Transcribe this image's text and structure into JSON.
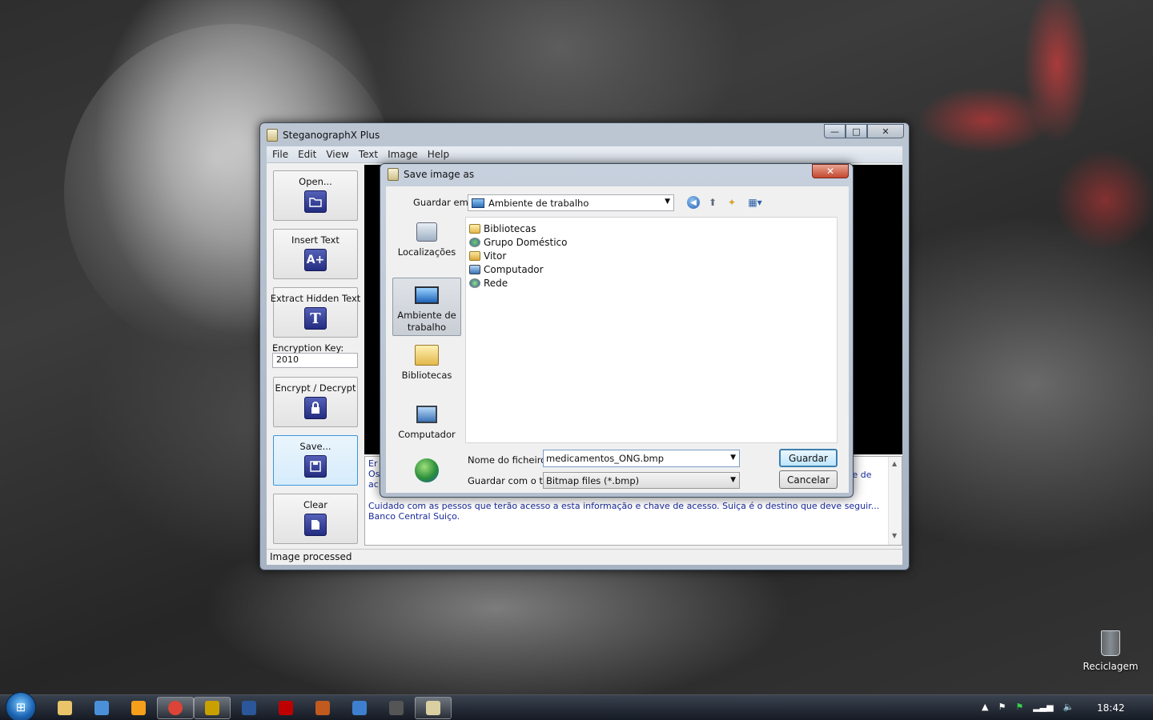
{
  "main_window": {
    "title": "SteganographX Plus",
    "menu": [
      "File",
      "Edit",
      "View",
      "Text",
      "Image",
      "Help"
    ],
    "buttons": {
      "open": "Open...",
      "insert_text": "Insert Text",
      "extract_hidden_text": "Extract Hidden Text",
      "encrypt_decrypt": "Encrypt / Decrypt",
      "save": "Save...",
      "clear": "Clear"
    },
    "icon_glyphs": {
      "insert": "A+",
      "extract": "T"
    },
    "encryption_key_label": "Encryption Key:",
    "encryption_key_value": "2010",
    "text_content": {
      "left_fragment_1": "Er",
      "left_fragment_2": "Os",
      "left_fragment_3": "ac",
      "right_fragment": "ve de",
      "line": "Cuidado com as pessos que terão acesso a esta informação e chave de acesso. Suiça é o destino que deve seguir... Banco Central Suiço."
    },
    "status": "Image processed",
    "caption_buttons": {
      "minimize": "—",
      "maximize": "□",
      "close": "✕"
    }
  },
  "save_dialog": {
    "title": "Save image as",
    "close_glyph": "✕",
    "look_in_label": "Guardar em:",
    "look_in_value": "Ambiente de trabalho",
    "places": [
      {
        "label": "Localizações",
        "icon": "recent-places-icon"
      },
      {
        "label": "Ambiente de trabalho",
        "icon": "desktop-icon"
      },
      {
        "label": "Bibliotecas",
        "icon": "libraries-icon"
      },
      {
        "label": "Computador",
        "icon": "computer-icon"
      },
      {
        "label": "",
        "icon": "network-icon"
      }
    ],
    "files": [
      {
        "name": "Bibliotecas",
        "icon": "libraries-icon"
      },
      {
        "name": "Grupo Doméstico",
        "icon": "homegroup-icon"
      },
      {
        "name": "Vitor",
        "icon": "user-folder-icon"
      },
      {
        "name": "Computador",
        "icon": "computer-icon"
      },
      {
        "name": "Rede",
        "icon": "network-icon"
      }
    ],
    "filename_label": "Nome do ficheiro:",
    "filename_value": "medicamentos_ONG.bmp",
    "filetype_label": "Guardar com o tipo:",
    "filetype_value": "Bitmap files (*.bmp)",
    "save_button": "Guardar",
    "cancel_button": "Cancelar"
  },
  "desktop": {
    "recycle_bin_label": "Reciclagem"
  },
  "taskbar": {
    "apps": [
      {
        "name": "explorer-icon",
        "color": "#e9c46a"
      },
      {
        "name": "network-users-icon",
        "color": "#4a90d9"
      },
      {
        "name": "media-player-icon",
        "color": "#f59f1b"
      },
      {
        "name": "chrome-icon",
        "color": "#db4437"
      },
      {
        "name": "fireworks-icon",
        "color": "#c8a000"
      },
      {
        "name": "word-icon",
        "color": "#2b579a"
      },
      {
        "name": "filezilla-icon",
        "color": "#bf0000"
      },
      {
        "name": "film-icon",
        "color": "#c05a1f"
      },
      {
        "name": "window-icon",
        "color": "#3f7fcf"
      },
      {
        "name": "clapper-icon",
        "color": "#555555"
      },
      {
        "name": "steganographx-icon",
        "color": "#d9cfa0"
      }
    ],
    "active_index": 10,
    "clock": "18:42"
  }
}
